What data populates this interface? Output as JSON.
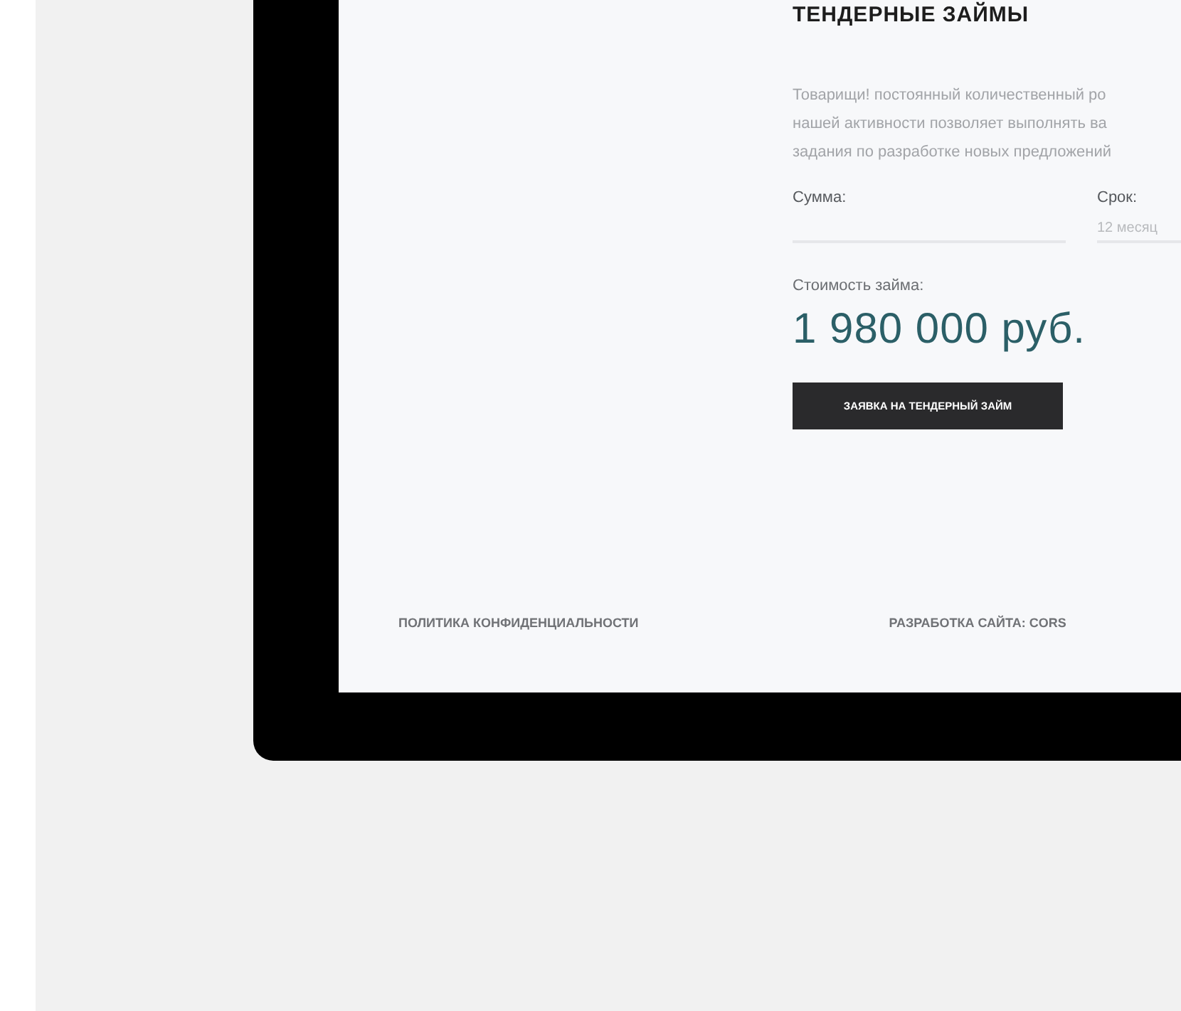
{
  "page": {
    "title": "ТЕНДЕРНЫЕ ЗАЙМЫ",
    "description_lines": [
      "Товарищи! постоянный количественный ро",
      "нашей активности позволяет выполнять ва",
      "задания по разработке новых предложений"
    ],
    "fields": [
      {
        "label": "Сумма:"
      },
      {
        "label": "Срок:",
        "value": "12 месяц"
      }
    ],
    "cost_label": "Стоимость займа:",
    "cost_value": "1 980 000 руб.",
    "button": "ЗАЯВКА НА ТЕНДЕРНЫЙ ЗАЙМ"
  },
  "footer": {
    "links": [
      "ПОЛИТИКА КОНФИДЕНЦИАЛЬНОСТИ",
      "РАЗРАБОТКА САЙТА: CORS"
    ]
  }
}
